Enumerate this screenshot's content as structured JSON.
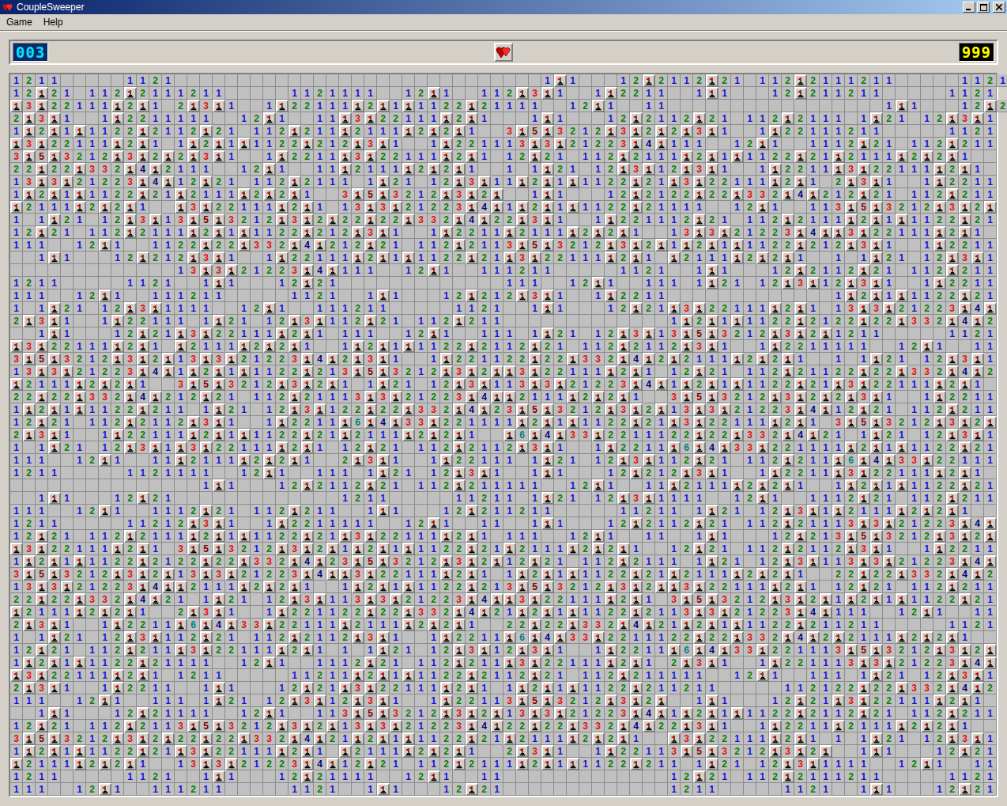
{
  "window": {
    "title": "CoupleSweeper"
  },
  "menu": [
    "Game",
    "Help"
  ],
  "mine_counter": "003",
  "timer": "999",
  "board": {
    "rows": [
      "1211.....1121.............................1F1...12F2112F21.112F2111211.....1121111..12F1..11",
      "12F21.112F2111211.....1121111..12F1..112F3F1..1F2211..1F1...12F211211.....1121",
      "F3F22111F2F1.2F3F1..1F22111F2F1F1122F21111..12F1..11.................1F1...12F21",
      "2F3F1..1F2211111..12F1..11F3F22111F2F1...1F1...12F2112F21.112F2111.1F21.12F3F1",
      "1F2F1F1122F2112F21.112F211F2111F2F2F1..3F5F3212F3F2F2F3F1..1F22111211.....1121",
      "F3F22111F2F1.1F2F1F1122F212F3F1..1F221113F3F21223F4F111..12F1..1112F21.112F211",
      "3F5F3212F3F2F2F3F1..1F2211F3F22111F2F1.12F21.112F2111F2F1F1122F21F2111F2F2F1..",
      "22F22F332F4F2111..12F1..11F2111F2F2F1..1.1F21.12F3F12F3F1..1F2211F3F22111F2F1.",
      "13F3F21223F4F12F21.112F2111.1F21.12F3F11F2F1F1122F21F3F22111F2F1.2F3F1..1F2211",
      "1F2F1F1122F21F2111F2F2F1..3F5F3212F3F2F..1F1...12F2122F22F332F4F212F21.112F211",
      "F2111F2F2F1..F3F22111F2F1.13F3F21223F4F1F2F1F1122F21111..12F1..113F5F3212F3F2F",
      "1.1F21.12F3F13F5F3212F3F2F22F22F332F4F22F3F1..1F221112F21.112F2111F2F1F1122F21",
      "12F21.112F2111F2F1F1122F212F3F1..1F2211F2111F2F2F1..13F3F21223F4FF3F22111F2F1.",
      "111..12F1..1122F22F332F4F212F21.112F2113F5F3212F3F2F1F2F1F1122F212F3F1..1F2211",
      "..1F1...12F212F3F1..1F22111F2F1F1122F21F3F22111F2F1.F2111F2F2F1..1.1F21.12F3F1",
      ".............13F3F21223F4F111..12F1..111211.....1121..1F1...12F2112F21.112F211",
      "1211.....1121..1F1...12F21.............111..12F1..111.1F21.12F3F12F3F1..1F2211",
      "111..12F1..111211.....1121..1F1...12F212F3F1..1F2211.............1F2F1F1122F21",
      "1.1F21.12F3F1111..12F1..111211.....1121..1F1...12F21F3F22111F2F1.13F3F21223F4F",
      "2F3F1..1F22111.1F21.12F3F112F21.112F211.............1F2F1F1122F2122F22F332F4F2",
      "..1F1...12F21F3F22111F2F1.111..12F1..111.1F21.12F3F13F5F3212F3F2F1211.....1121",
      "F3F22111F2F1.F2111F2F2F1..1F2F1F1122F2112F21.112F2112F3F1..1F2211111..12F1..11",
      "3F5F3212F3F2F13F3F21223F4F2F3F1..1F221122F22F332F4F2F2111F2F2F1..1.1F21.12F3F1",
      "13F3F21223F4F1F2F1F1122F213F5F3212F3F2FF3F22111F2F1.12F21.112F21122F22F332F4F2",
      "F2111F2F2F1..3F5F3212F3F2F1.1F21.12F3F113F3F21223F4F1F2F1F1122F21F3F22111F2F1.",
      "22F22F332F4F212F21.112F21113F3F21223F4FF2111F2F2F1..3F5F3212F3F2F2F3F1..1F2211",
      "1F2F1F1122F211.1F21.12F3F122F22F332F4F23F5F3212F3F2F13F3F21223F4F12F21.112F211",
      "12F21.112F2112F3F1..1F2211F6F4F33F221111F2F1F1122F21F3F22111F2F1.3F5F3212F3F2F",
      "2F3F1..1F22111F2F1F1122F21F2111F2F2F1..F6F4F33F2211122F22F332F4F21.1F21.12F3F1",
      "1.1F21.12F3F1F3F22111F2F1.12F21.112F2112F3F1..1F2211F6F4F33F221111F2F1F1122F21",
      "111..12F1..11F2111F2F2F1..2F3F1..1F22111.1F21.12F3F112F21.112F211F6F4F33F22111",
      "1211.....1121111..12F1..111.1F21.12F3F1..1F1...12F212F3F1..1F2211F3F22111F2F1.",
      "...............1F1...12F2112F21.112F211111..12F1..11F2111F2F2F1..1F2F1F1122F21",
      "..1F1...12F21.............1211.....11211.1F21.12F3F1111..12F1..1112F21.112F211",
      "111..12F1..1112F21.112F211..1F1...12F211211.....11211.1F21.12F3F1F2111F2F2F1..",
      "1211.....11212F3F1..1F2211111..12F1..11..1F1...12F2112F21.112F21113F3F21223F4F",
      "12F21.112F2111F2F1F1122F21F3F22111F2F1.111..12F1..11..1F1...12F213F5F3212F3F2F",
      "F3F22111F2F1.3F5F3212F3F2F1F2F1F1122F21F2111F2F2F1..12F21.112F2112F3F1..1F2211",
      "1F2F1F1122F2122F22F332F4F23F5F3212F3F2F12F21.112F2111.1F21.12F3F113F3F21223F4F",
      "3F5F3212F3F2F13F3F21223F4FF3F22111F2F1.1F2F1F1122F21F2111F2F2F1..22F22F332F4F2",
      "13F3F21223F4FF2111F2F2F1..1F2F1F1122F213F5F3212F3F2FF3F22111F2F1.12F21.112F211",
      "22F22F332F4F21.1F21.12F3F113F3F21223F4FF3F22111F2F1.3F5F3212F3F2F1F2F1F1122F21",
      "F2111F2F2F1..2F3F1..1F221122F22F332F4F21F2F1F1122F2113F3F21223F4F111..12F1..11",
      "2F3F1..1F2211F6F4F33F22111F2111F2F2F1..22F22F332F4F21F2F1F1122F211211.....1121",
      "1.1F21.12F3F112F21.112F2112F3F1..1F2211F6F4F33F2211122F22F332F4F2F2111F2F2F1..",
      "12F21.112F211F3F22111F2F1.1.1F21.12F3F12F3F1..1F2211F6F4F33F221113F5F3212F3F2F",
      "1F2F1F1122F21111..12F1..1112F21.112F211F3F22111F2F1.2F3F1..1F221113F3F21223F4F",
      "F3F22111F2F1.1211.....11211F2F1F1122F2112F21.112F211111..12F1..111.1F21.12F3F1",
      "2F3F1..1F2211..1F1...12F21F3F22111F2F1.1F2F1F1122F211211.....112122F22F332F4F2",
      "111..12F1..111.1F21.12F3F12F3F1..1F22113F5F3212F3F2F..1F1...12F21F3F22111F2F1.",
      "..1F1...12F21111..12F1..113F5F3212F3F2F13F3F21223F4F1F2F1F1122F2112F21.112F211",
      "12F21.112F2113F5F3212F3F2F13F3F21223F4F22F22F332F4F22F3F1..1F2211F2111F2F2F1..",
      "3F5F3212F3F2F22F22F332F4F21F2F1F1122F21F2111F2F2F1..F3F22111F2F1.1.1F21.12F3F1",
      "1F2F1F1122F21F3F22111F2F1.F2111F2F2F1..2F3F1..1F22113F5F3212F3F2F..1F1...12F21",
      "F2111F2F2F1..13F3F21223F4F12F21.112F2111F2F1F1122F211.1F21.12F3F1111..12F1..11",
      "1211.....1121..1F1...12F21111..12F1..11.............12F21.112F2111211.....1121",
      "111..12F1..111211.....1121..1F1...12F21.............1211.....1121..1F1...12F21"
    ]
  }
}
